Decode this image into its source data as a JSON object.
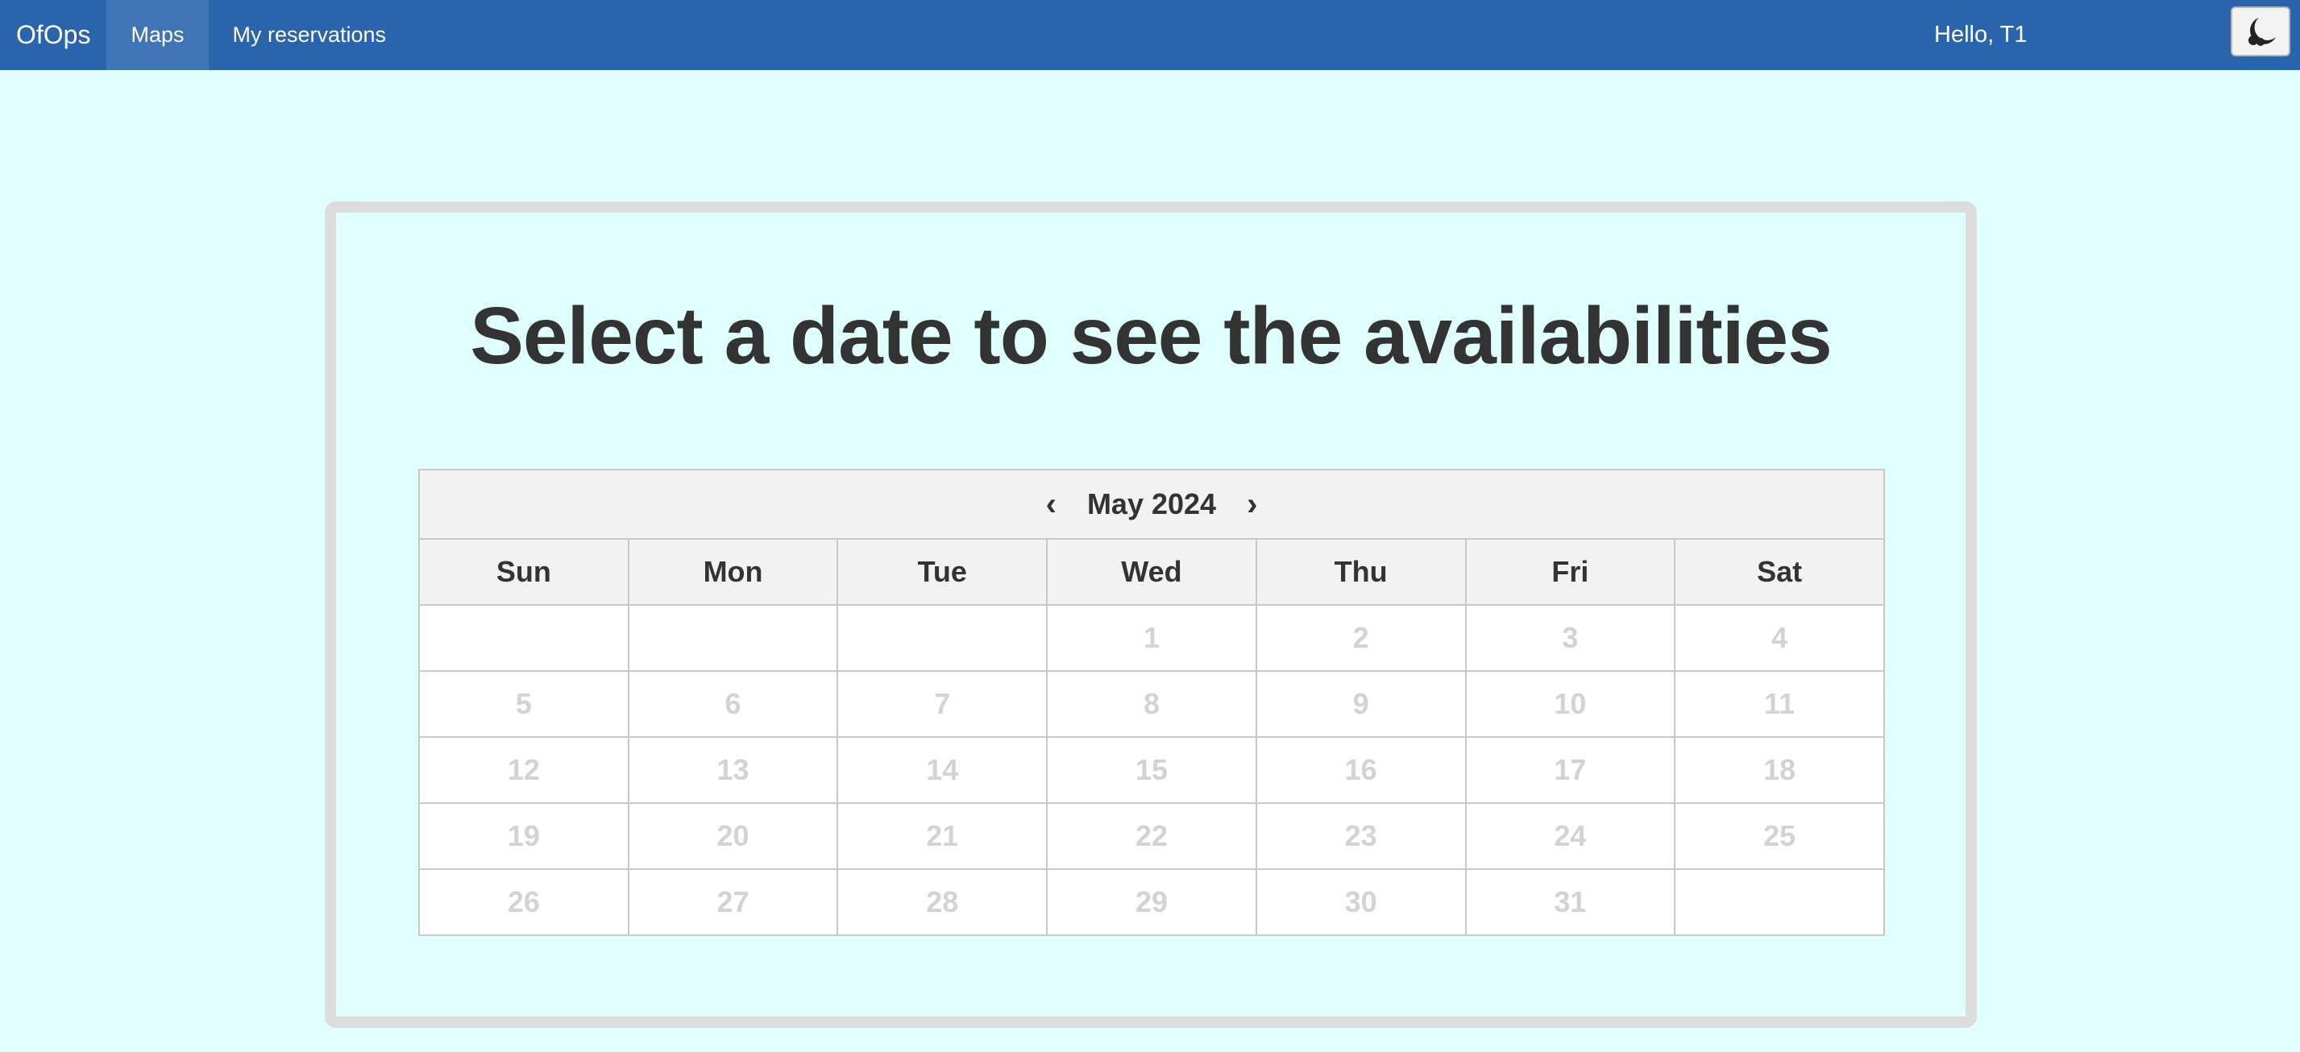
{
  "navbar": {
    "brand": "OfOps",
    "items": [
      {
        "label": "Maps",
        "active": true
      },
      {
        "label": "My reservations",
        "active": false
      }
    ],
    "greeting": "Hello, T1",
    "theme_toggle_icon": "moon-icon"
  },
  "colors": {
    "navbar_bg": "#2a64ad",
    "page_bg": "#e0ffff",
    "card_border": "#dcdcdc",
    "disabled_day": "#d3d3d3"
  },
  "main": {
    "title": "Select a date to see the availabilities"
  },
  "calendar": {
    "prev_icon": "‹",
    "next_icon": "›",
    "month_label": "May 2024",
    "weekdays": [
      "Sun",
      "Mon",
      "Tue",
      "Wed",
      "Thu",
      "Fri",
      "Sat"
    ],
    "weeks": [
      [
        "",
        "",
        "",
        "1",
        "2",
        "3",
        "4"
      ],
      [
        "5",
        "6",
        "7",
        "8",
        "9",
        "10",
        "11"
      ],
      [
        "12",
        "13",
        "14",
        "15",
        "16",
        "17",
        "18"
      ],
      [
        "19",
        "20",
        "21",
        "22",
        "23",
        "24",
        "25"
      ],
      [
        "26",
        "27",
        "28",
        "29",
        "30",
        "31",
        ""
      ]
    ]
  }
}
